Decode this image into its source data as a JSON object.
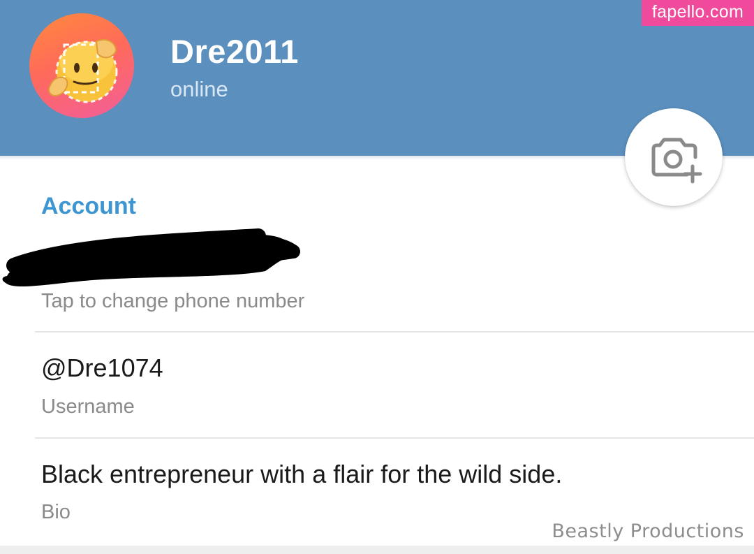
{
  "profile": {
    "name": "Dre2011",
    "status": "online",
    "avatar_emoji": "face-with-dotted-line-emoji"
  },
  "watermark_top": "fapello.com",
  "camera_button": {
    "icon": "camera-add-icon"
  },
  "account": {
    "section_title": "Account",
    "phone_caption": "Tap to change phone number",
    "username": "@Dre1074",
    "username_caption": "Username",
    "bio": "Black entrepreneur with a flair for the wild side.",
    "bio_caption": "Bio"
  },
  "watermark_bottom": "Beastly Productions",
  "colors": {
    "header": "#5a8fbe",
    "accent": "#3d95d1",
    "watermark_badge": "#ef4a9c"
  }
}
